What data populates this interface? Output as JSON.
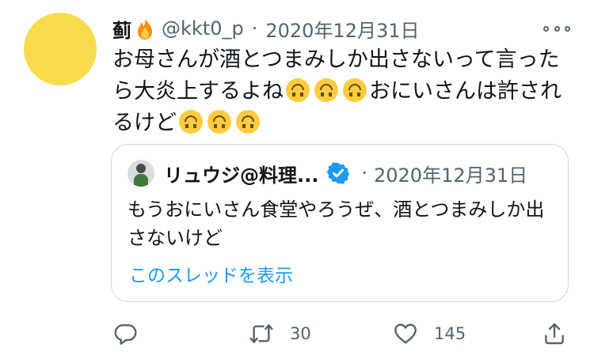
{
  "tweet": {
    "display_name": "蓟",
    "handle": "@kkt0_p",
    "separator": "·",
    "date": "2020年12月31日",
    "text_parts": [
      "お母さんが酒とつまみしか出さないって言ったら大炎上するよね",
      "おにいさんは許されるけど"
    ],
    "emoji_name": "upside-down-face"
  },
  "quote": {
    "display_name": "リュウジ@料理...",
    "separator": "·",
    "date": "2020年12月31日",
    "text": "もうおにいさん食堂やろうぜ、酒とつまみしか出さないけど",
    "thread_link": "このスレッドを表示"
  },
  "actions": {
    "reply_icon": "reply-icon",
    "retweet_icon": "retweet-icon",
    "retweet_count": "30",
    "like_icon": "heart-icon",
    "like_count": "145",
    "share_icon": "share-icon"
  },
  "colors": {
    "accent": "#1d9bf0",
    "secondary_text": "#536471",
    "avatar": "#f9dc4e"
  }
}
